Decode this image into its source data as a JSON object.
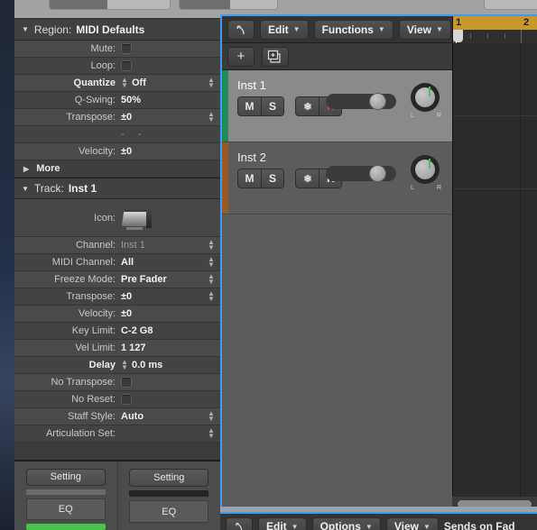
{
  "inspector": {
    "region": {
      "header_label": "Region:",
      "header_name": "MIDI Defaults",
      "rows": [
        {
          "label": "Mute:",
          "value": "",
          "type": "checkbox"
        },
        {
          "label": "Loop:",
          "value": "",
          "type": "checkbox"
        },
        {
          "label": "Quantize",
          "value": "Off",
          "type": "stepper-both"
        },
        {
          "label": "Q-Swing:",
          "value": "50%",
          "type": "text"
        },
        {
          "label": "Transpose:",
          "value": "±0",
          "type": "stepper"
        },
        {
          "label": "",
          "value": "-  -",
          "type": "dash"
        },
        {
          "label": "Velocity:",
          "value": "±0",
          "type": "text"
        }
      ],
      "more_label": "More"
    },
    "track": {
      "header_label": "Track:",
      "header_name": "Inst 1",
      "icon_label": "Icon:",
      "icon_name": "grand-piano-icon",
      "rows": [
        {
          "label": "Channel:",
          "value": "Inst 1",
          "type": "stepper",
          "dim": true
        },
        {
          "label": "MIDI Channel:",
          "value": "All",
          "type": "stepper"
        },
        {
          "label": "Freeze Mode:",
          "value": "Pre Fader",
          "type": "stepper"
        },
        {
          "label": "Transpose:",
          "value": "±0",
          "type": "stepper"
        },
        {
          "label": "Velocity:",
          "value": "±0",
          "type": "text"
        },
        {
          "label": "Key Limit:",
          "value": "C-2  G8",
          "type": "text"
        },
        {
          "label": "Vel Limit:",
          "value": "1   127",
          "type": "text"
        },
        {
          "label": "Delay",
          "value": "0.0 ms",
          "type": "stepper-left"
        },
        {
          "label": "No Transpose:",
          "value": "",
          "type": "checkbox"
        },
        {
          "label": "No Reset:",
          "value": "",
          "type": "checkbox"
        },
        {
          "label": "Staff Style:",
          "value": "Auto",
          "type": "stepper"
        },
        {
          "label": "Articulation Set:",
          "value": "",
          "type": "stepper"
        }
      ]
    },
    "channel_strips": [
      {
        "setting_label": "Setting",
        "eq_label": "EQ",
        "meter": "light"
      },
      {
        "setting_label": "Setting",
        "eq_label": "EQ",
        "meter": "dark"
      }
    ]
  },
  "arrange": {
    "menu_bar": {
      "undo_icon": "undo-arrow-icon",
      "menus": [
        "Edit",
        "Functions",
        "View"
      ],
      "automation_icon": "automation-curve-icon",
      "flex_icon": "flex-time-icon"
    },
    "track_controls": {
      "add_track_label": "+",
      "duplicate_icon": "duplicate-track-icon",
      "collapse_icon": "chevron-down-box-icon"
    },
    "ruler": {
      "bars": [
        "1",
        "2"
      ],
      "cycle_color": "#c9972a"
    },
    "tracks": [
      {
        "name": "Inst 1",
        "color": "#1f8a5a",
        "selected": true,
        "buttons": [
          "M",
          "S"
        ],
        "buttons2": [
          "❄",
          "R"
        ],
        "record_armed": true,
        "pan_left_label": "L",
        "pan_right_label": "R"
      },
      {
        "name": "Inst 2",
        "color": "#9c5a22",
        "selected": false,
        "buttons": [
          "M",
          "S"
        ],
        "buttons2": [
          "❄",
          "R"
        ],
        "record_armed": false,
        "pan_left_label": "L",
        "pan_right_label": "R"
      }
    ]
  },
  "mixer_bar": {
    "undo_icon": "undo-arrow-icon",
    "menus": [
      "Edit",
      "Options",
      "View"
    ],
    "sends_label": "Sends on Fad"
  },
  "colors": {
    "focus_border": "#3f9bf0",
    "accent_blue": "#3f8fe0",
    "record_red": "#e8403a",
    "cycle_gold": "#c9972a",
    "track1": "#1f8a5a",
    "track2": "#9c5a22",
    "green_meter": "#49c54d"
  }
}
